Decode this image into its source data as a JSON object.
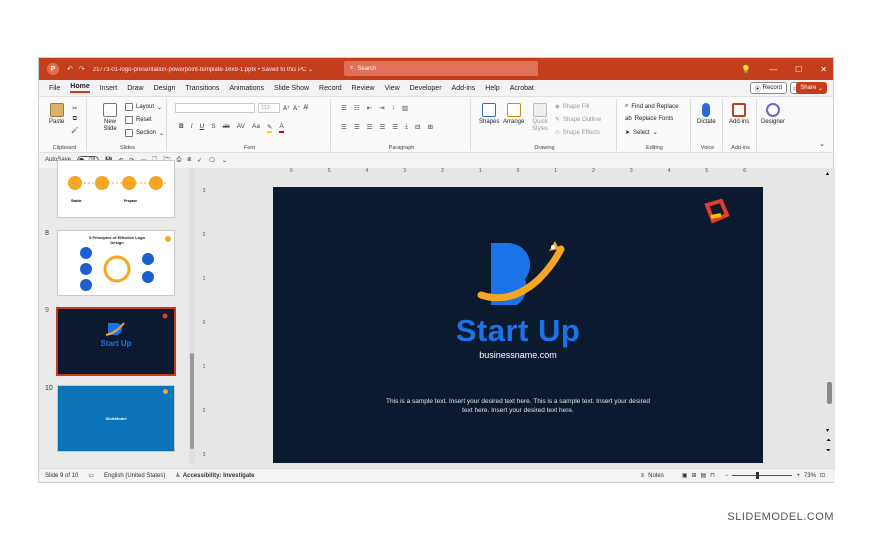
{
  "window": {
    "doc_title": "21773-01-logo-presentation-powerpoint-template-16x9-1.pptx • Saved to this PC ⌄",
    "search_placeholder": "Search",
    "controls": [
      "💡",
      "—",
      "☐",
      "✕"
    ]
  },
  "menu": {
    "tabs": [
      "File",
      "Home",
      "Insert",
      "Draw",
      "Design",
      "Transitions",
      "Animations",
      "Slide Show",
      "Record",
      "Review",
      "View",
      "Developer",
      "Add-ins",
      "Help",
      "Acrobat"
    ],
    "active": "Home",
    "record_label": "Record",
    "share_label": "Share"
  },
  "ribbon": {
    "clipboard": {
      "paste": "Paste",
      "label": "Clipboard"
    },
    "slides": {
      "new_slide": "New Slide",
      "layout": "Layout",
      "reset": "Reset",
      "section": "Section",
      "label": "Slides"
    },
    "font": {
      "size": "113",
      "label": "Font",
      "format_buttons": [
        "B",
        "I",
        "U",
        "S",
        "ab",
        "AV",
        "Aa",
        "A"
      ]
    },
    "paragraph": {
      "label": "Paragraph"
    },
    "drawing": {
      "shapes": "Shapes",
      "arrange": "Arrange",
      "quick_styles": "Quick Styles",
      "shape_fill": "Shape Fill",
      "shape_outline": "Shape Outline",
      "shape_effects": "Shape Effects",
      "label": "Drawing"
    },
    "editing": {
      "find_replace": "Find and Replace",
      "replace_fonts": "Replace Fonts",
      "select": "Select",
      "label": "Editing"
    },
    "voice": {
      "dictate": "Dictate",
      "label": "Voice"
    },
    "addins": {
      "addins": "Add-ins",
      "label": "Add-ins"
    },
    "designer": {
      "label": "Designer"
    }
  },
  "qat": {
    "autosave": "AutoSave",
    "toggle": "Off"
  },
  "thumbnails": [
    {
      "num": "",
      "title": "",
      "labels": [
        "Stable",
        "Prepare"
      ]
    },
    {
      "num": "8",
      "title": "5 Principles of Effective Logo Design",
      "labels": []
    },
    {
      "num": "9",
      "title": "Start Up",
      "labels": []
    },
    {
      "num": "10",
      "title": "SlideModel",
      "labels": []
    }
  ],
  "ruler": {
    "h": [
      "6",
      "5",
      "4",
      "3",
      "2",
      "1",
      "0",
      "1",
      "2",
      "3",
      "4",
      "5",
      "6"
    ],
    "v": [
      "3",
      "2",
      "1",
      "0",
      "1",
      "2",
      "3"
    ]
  },
  "slide": {
    "title": "Start Up",
    "url": "businessname.com",
    "body": "This is a sample text. Insert your desired text here. This is a sample text. Insert your desired text here.  Insert your desired text here."
  },
  "status": {
    "slide_of": "Slide 9 of 10",
    "language": "English (United States)",
    "accessibility": "Accessibility: Investigate",
    "notes": "Notes",
    "zoom": "73%"
  },
  "watermark": "SLIDEMODEL.COM",
  "colors": {
    "accent": "#c43e1c",
    "slide_bg": "#0b1a2e",
    "brand_blue": "#1a73e8",
    "brand_orange": "#f5a623"
  }
}
